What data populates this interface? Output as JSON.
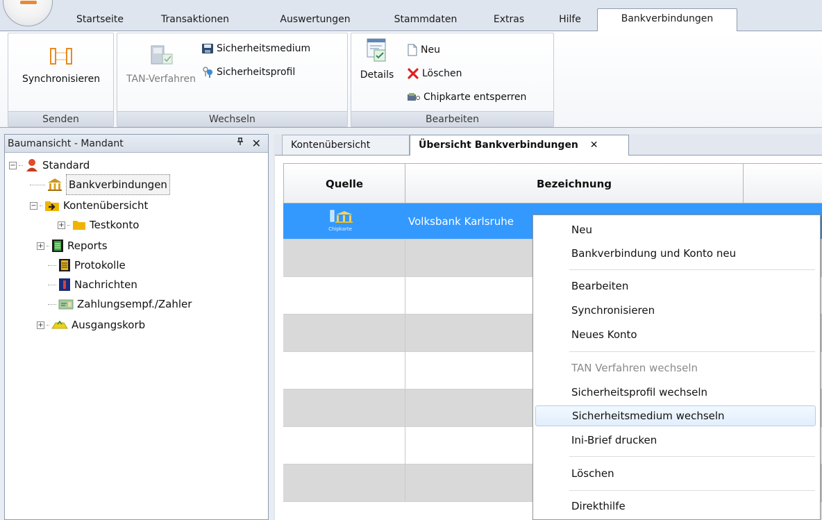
{
  "ribbon_tabs": [
    "Startseite",
    "Transaktionen",
    "Auswertungen",
    "Stammdaten",
    "Extras",
    "Hilfe",
    "Bankverbindungen"
  ],
  "ribbon": {
    "senden": {
      "label": "Senden",
      "synchronisieren": "Synchronisieren"
    },
    "wechseln": {
      "label": "Wechseln",
      "tan_verfahren": "TAN-Verfahren",
      "sicherheitsmedium": "Sicherheitsmedium",
      "sicherheitsprofil": "Sicherheitsprofil"
    },
    "bearbeiten": {
      "label": "Bearbeiten",
      "details": "Details",
      "neu": "Neu",
      "loeschen": "Löschen",
      "chipkarte": "Chipkarte entsperren"
    }
  },
  "tree": {
    "title": "Baumansicht - Mandant",
    "pin": "ᵖ",
    "close": "✕",
    "nodes": {
      "standard": "Standard",
      "bankverbindungen": "Bankverbindungen",
      "kontenuebersicht": "Kontenübersicht",
      "testkonto": "Testkonto",
      "reports": "Reports",
      "protokolle": "Protokolle",
      "nachrichten": "Nachrichten",
      "zahlungsempf": "Zahlungsempf./Zahler",
      "ausgangskorb": "Ausgangskorb"
    }
  },
  "doc_tabs": {
    "konten": "Kontenübersicht",
    "uebersicht": "Übersicht Bankverbindungen",
    "close": "✕"
  },
  "grid": {
    "col_quelle": "Quelle",
    "col_bezeichnung": "Bezeichnung",
    "row1_name": "Volksbank Karlsruhe",
    "row1_icon_label": "Chipkarte"
  },
  "context_menu": {
    "neu": "Neu",
    "bank_konto_neu": "Bankverbindung und Konto neu",
    "bearbeiten": "Bearbeiten",
    "synchronisieren": "Synchronisieren",
    "neues_konto": "Neues Konto",
    "tan_wechseln": "TAN Verfahren wechseln",
    "profil_wechseln": "Sicherheitsprofil wechseln",
    "medium_wechseln": "Sicherheitsmedium wechseln",
    "ini_brief": "Ini-Brief drucken",
    "loeschen": "Löschen",
    "direkthilfe": "Direkthilfe"
  },
  "colors": {
    "selection": "#3399ff",
    "menu_hover": "#e2eefc",
    "accent": "#e98a3a"
  }
}
